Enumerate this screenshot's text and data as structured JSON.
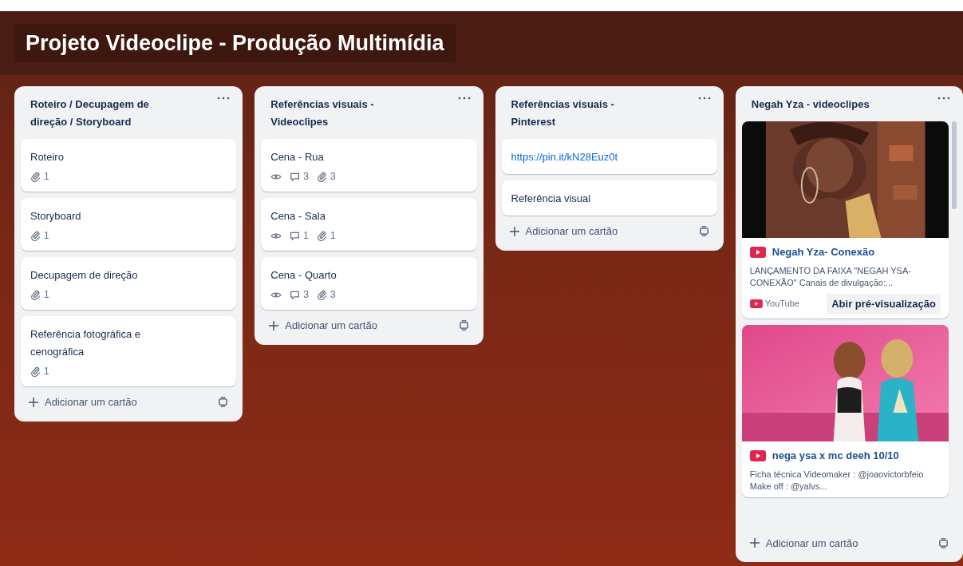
{
  "board": {
    "title": "Projeto Videoclipe - Produção Multimídia"
  },
  "lists": [
    {
      "title": "Roteiro / Decupagem de direção / Storyboard",
      "add_label": "Adicionar um cartão",
      "cards": [
        {
          "kind": "text",
          "title": "Roteiro",
          "badges": [
            {
              "kind": "attachment",
              "count": "1"
            }
          ]
        },
        {
          "kind": "text",
          "title": "Storyboard",
          "badges": [
            {
              "kind": "attachment",
              "count": "1"
            }
          ]
        },
        {
          "kind": "text",
          "title": "Decupagem de direção",
          "badges": [
            {
              "kind": "attachment",
              "count": "1"
            }
          ]
        },
        {
          "kind": "text",
          "title": "Referência fotográfica e cenográfica",
          "badges": [
            {
              "kind": "attachment",
              "count": "1"
            }
          ]
        }
      ]
    },
    {
      "title": "Referências visuais - Videoclipes",
      "add_label": "Adicionar um cartão",
      "cards": [
        {
          "kind": "text",
          "title": "Cena - Rua",
          "badges": [
            {
              "kind": "watch"
            },
            {
              "kind": "comment",
              "count": "3"
            },
            {
              "kind": "attachment",
              "count": "3"
            }
          ]
        },
        {
          "kind": "text",
          "title": "Cena - Sala",
          "badges": [
            {
              "kind": "watch"
            },
            {
              "kind": "comment",
              "count": "1"
            },
            {
              "kind": "attachment",
              "count": "1"
            }
          ]
        },
        {
          "kind": "text",
          "title": "Cena - Quarto",
          "badges": [
            {
              "kind": "watch"
            },
            {
              "kind": "comment",
              "count": "3"
            },
            {
              "kind": "attachment",
              "count": "3"
            }
          ]
        }
      ]
    },
    {
      "title": "Referências visuais - Pinterest",
      "add_label": "Adicionar um cartão",
      "cards": [
        {
          "kind": "link",
          "title": "https://pin.it/kN28Euz0t"
        },
        {
          "kind": "text",
          "title": "Referência visual"
        }
      ]
    },
    {
      "title": "Negah Yza - videoclipes",
      "add_label": "Adicionar um cartão",
      "cards": [
        {
          "kind": "video",
          "title": "Negah Yza- Conexão",
          "description": "LANÇAMENTO DA FAIXA \"NEGAH YSA-CONEXÃO\" Canais de divulgação:...",
          "source": "YouTube",
          "preview_button": "Abir pré-visualização"
        },
        {
          "kind": "video",
          "title": "nega ysa x mc deeh 10/10",
          "description": "Ficha técnica Videomaker : @joaovictorbfeio Make off : @yalvs..."
        }
      ]
    }
  ]
}
